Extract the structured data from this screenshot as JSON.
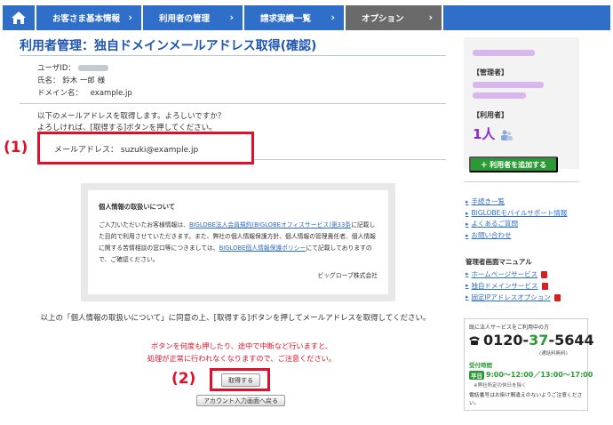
{
  "nav": {
    "tabs": [
      {
        "label": "お客さま基本情報"
      },
      {
        "label": "利用者の管理"
      },
      {
        "label": "請求実績一覧"
      },
      {
        "label": "オプション"
      }
    ],
    "arrow": "›"
  },
  "page": {
    "title": "利用者管理：独自ドメインメールアドレス取得(確認)",
    "user_id_label": "ユーザID：",
    "name_label": "氏名：",
    "name_value": "鈴木 一郎 様",
    "domain_label": "ドメイン名：",
    "domain_value": "example.jp",
    "message_line1": "以下のメールアドレスを取得します。よろしいですか？",
    "message_line2": "よろしければ、[取得する]ボタンを押してください。",
    "mail_label": "メールアドレス：",
    "mail_value": "suzuki@example.jp",
    "annotation1": "(1)",
    "annotation2": "(2)"
  },
  "privacy": {
    "title": "個人情報の取扱いについて",
    "text_a": "ご入力いただいたお客様情報は、",
    "link1": "BIGLOBE法人会員規約(BIGLOBEオフィスサービス)第33条",
    "text_b": "に記載した目的で利用させていただきます。また、弊社の個人情報保護方針、個人情報の管理責任者、個人情報に関する苦情相談の窓口等につきましては、",
    "link2": "BIGLOBE個人情報保護ポリシー",
    "text_c": "にて記載しておりますので、ご確認ください。",
    "signature": "ビッグローブ株式会社"
  },
  "agree_text": "以上の「個人情報の取扱いについて」に同意の上、[取得する]ボタンを押してメールアドレスを取得してください。",
  "warning": {
    "line1": "ボタンを何度も押したり、途中で中断など行いますと、",
    "line2": "処理が正常に行われなくなりますので、ご注意ください。"
  },
  "buttons": {
    "acquire": "取得する",
    "back": "アカウント入力画面へ戻る"
  },
  "sidebar": {
    "admin_header": "【管理者】",
    "user_header": "【利用者】",
    "user_count": "1人",
    "add_user": "＋ 利用者を追加する",
    "links": [
      {
        "label": "手続き一覧"
      },
      {
        "label": "BIGLOBEモバイルサポート情報"
      },
      {
        "label": "よくあるご質問"
      },
      {
        "label": "お問い合わせ"
      }
    ],
    "manual_title": "管理者画面マニュアル",
    "manual_links": [
      {
        "label": "ホームページサービス"
      },
      {
        "label": "独自ドメインサービス"
      },
      {
        "label": "固定IPアドレスオプション"
      }
    ],
    "contact": {
      "line1": "既に法人サービスをご利用中の方",
      "phone_a": "0120-",
      "phone_b": "37",
      "phone_c": "-5644",
      "phone_note": "(通話料無料)",
      "hours_title": "受付時間",
      "hours_pill": "平日",
      "hours": "9:00〜12:00／13:00〜17:00",
      "hours_note": "※弊社所定の休日を除く",
      "footer": "電話番号はお掛け間違えのないようご注意ください。"
    }
  }
}
